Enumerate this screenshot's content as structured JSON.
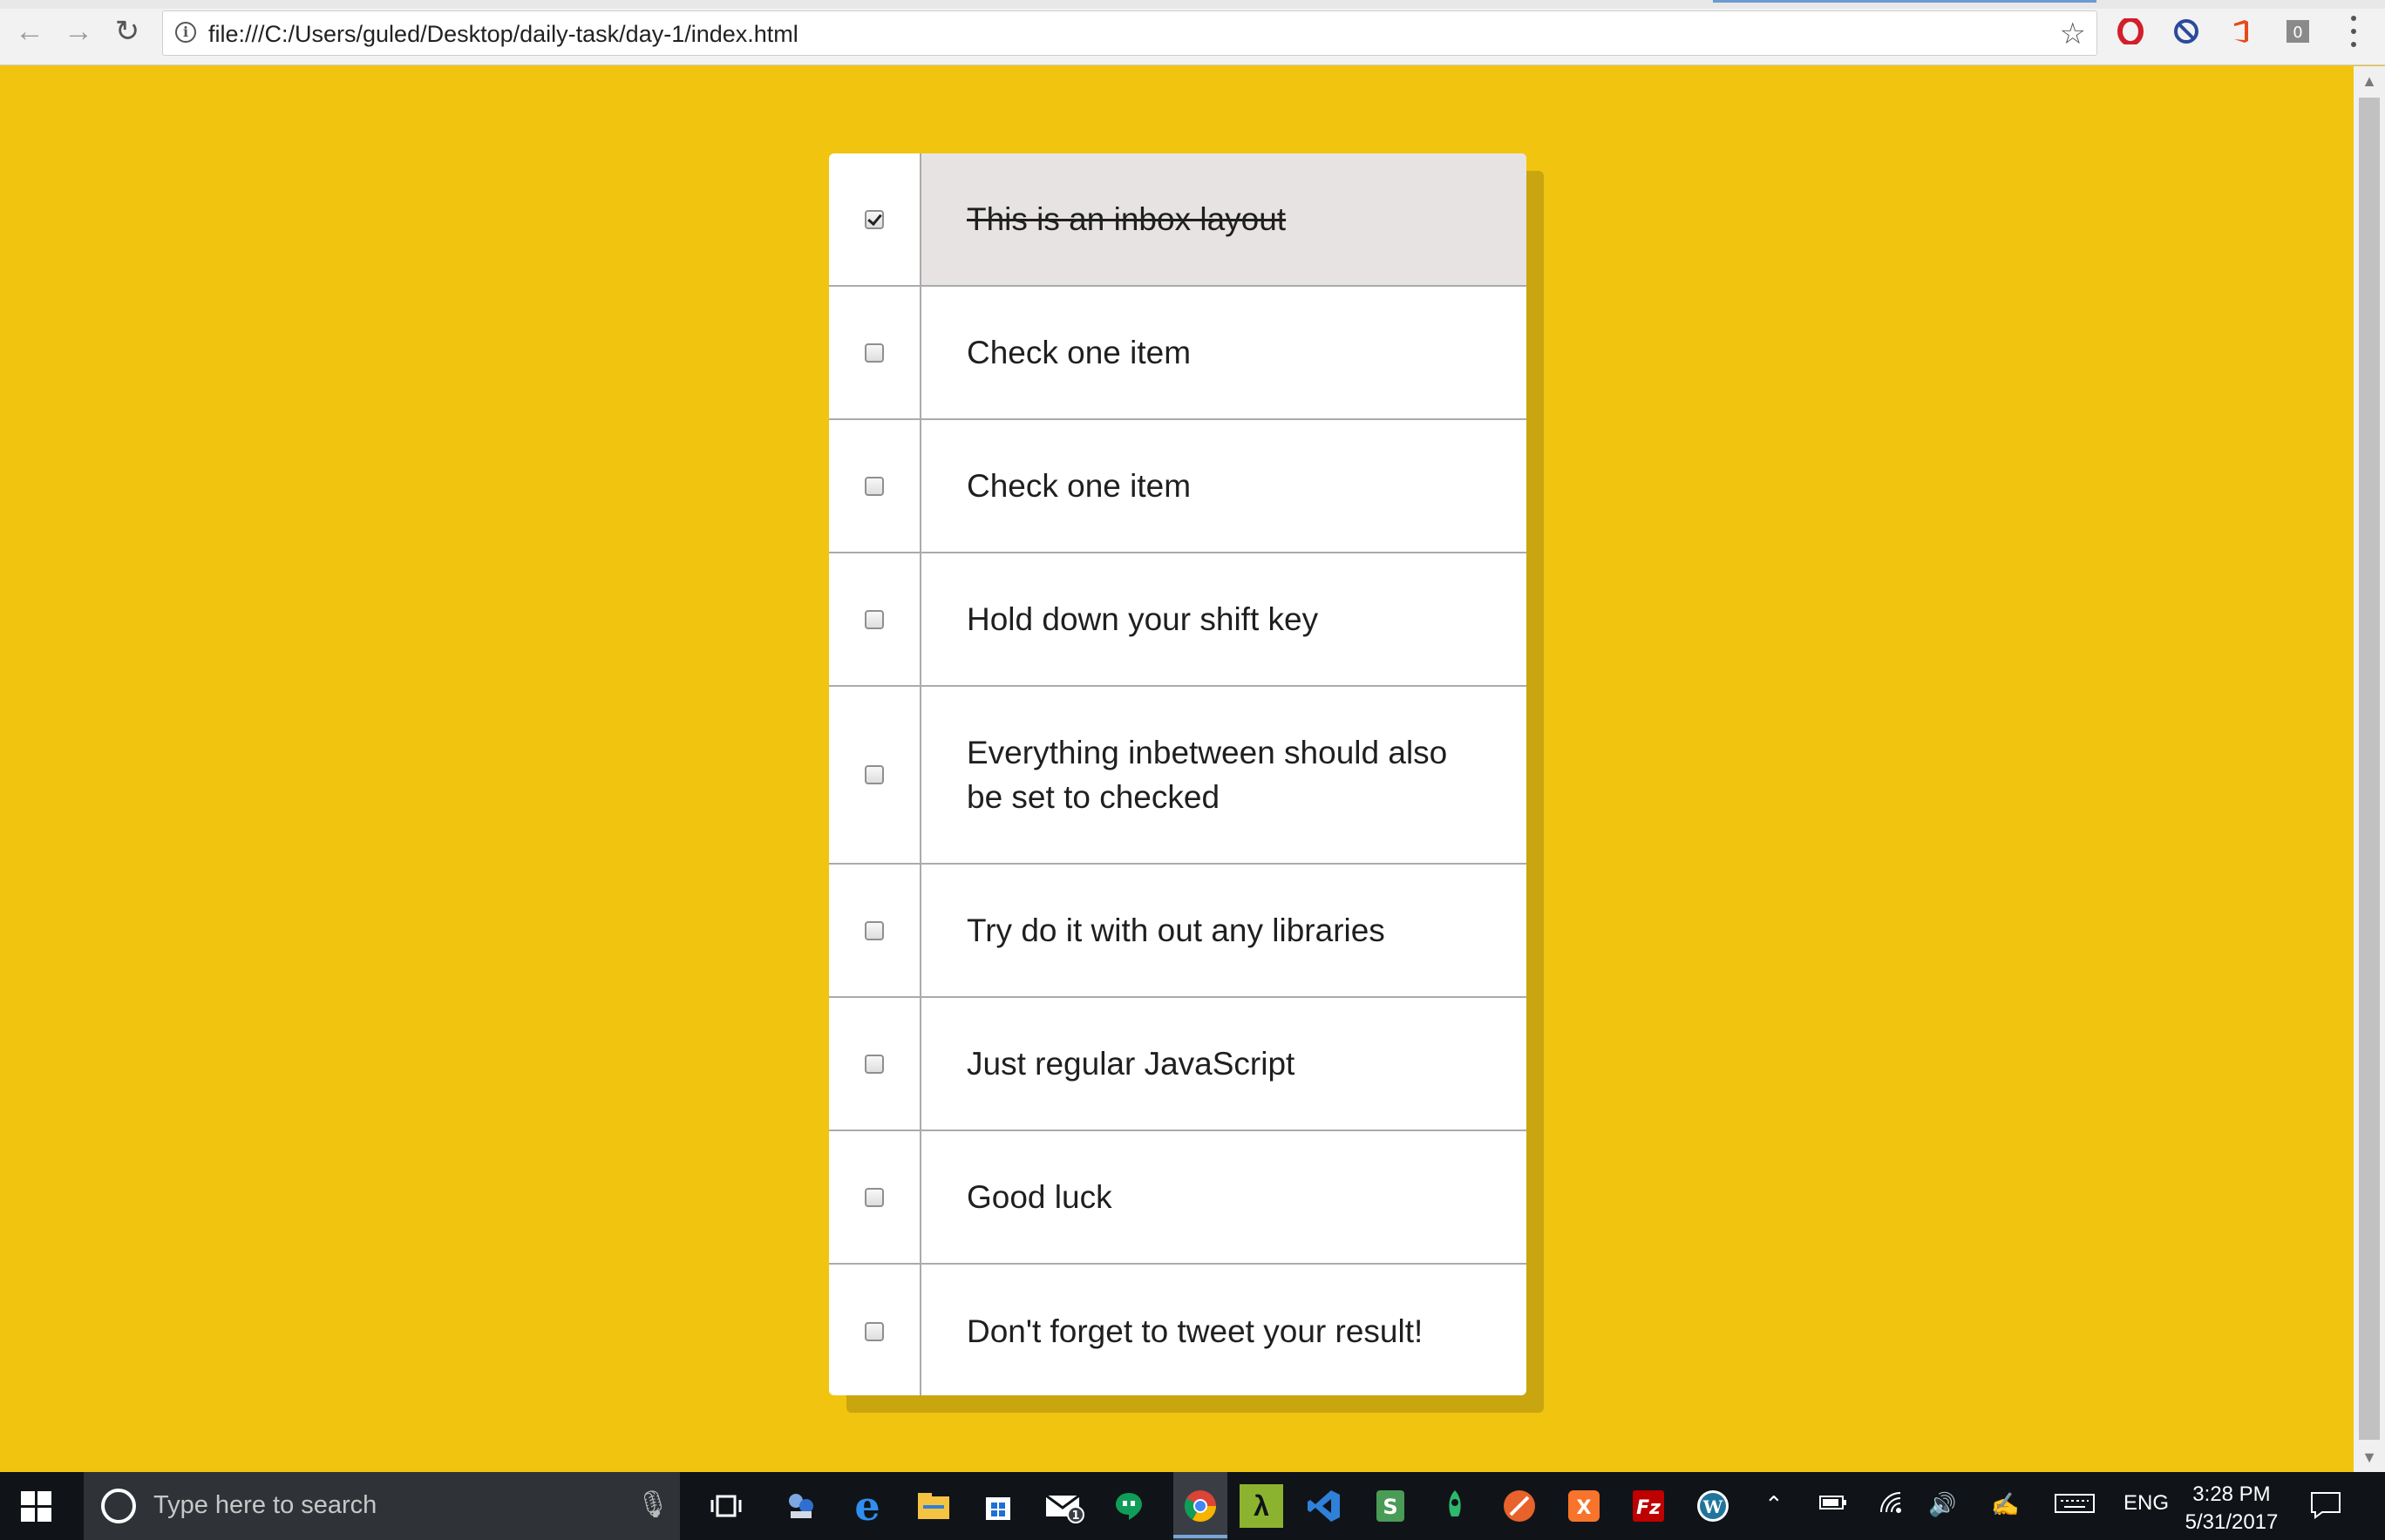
{
  "browser": {
    "url": "file:///C:/Users/guled/Desktop/daily-task/day-1/index.html",
    "extensions": [
      "opera-icon",
      "block-icon",
      "office-icon",
      "counter-icon"
    ]
  },
  "inbox": {
    "items": [
      {
        "label": "This is an inbox layout",
        "checked": true
      },
      {
        "label": "Check one item",
        "checked": false
      },
      {
        "label": "Check one item",
        "checked": false
      },
      {
        "label": "Hold down your shift key",
        "checked": false
      },
      {
        "label": "Everything inbetween should also be set to checked",
        "checked": false
      },
      {
        "label": "Try do it with out any libraries",
        "checked": false
      },
      {
        "label": "Just regular JavaScript",
        "checked": false
      },
      {
        "label": "Good luck",
        "checked": false
      },
      {
        "label": "Don't forget to tweet your result!",
        "checked": false
      }
    ]
  },
  "taskbar": {
    "search_placeholder": "Type here to search",
    "language": "ENG",
    "time": "3:28 PM",
    "date": "5/31/2017"
  },
  "colors": {
    "page_background": "#f1c40f",
    "shadow": "#c9a510",
    "done_row": "#e8e3e3"
  }
}
